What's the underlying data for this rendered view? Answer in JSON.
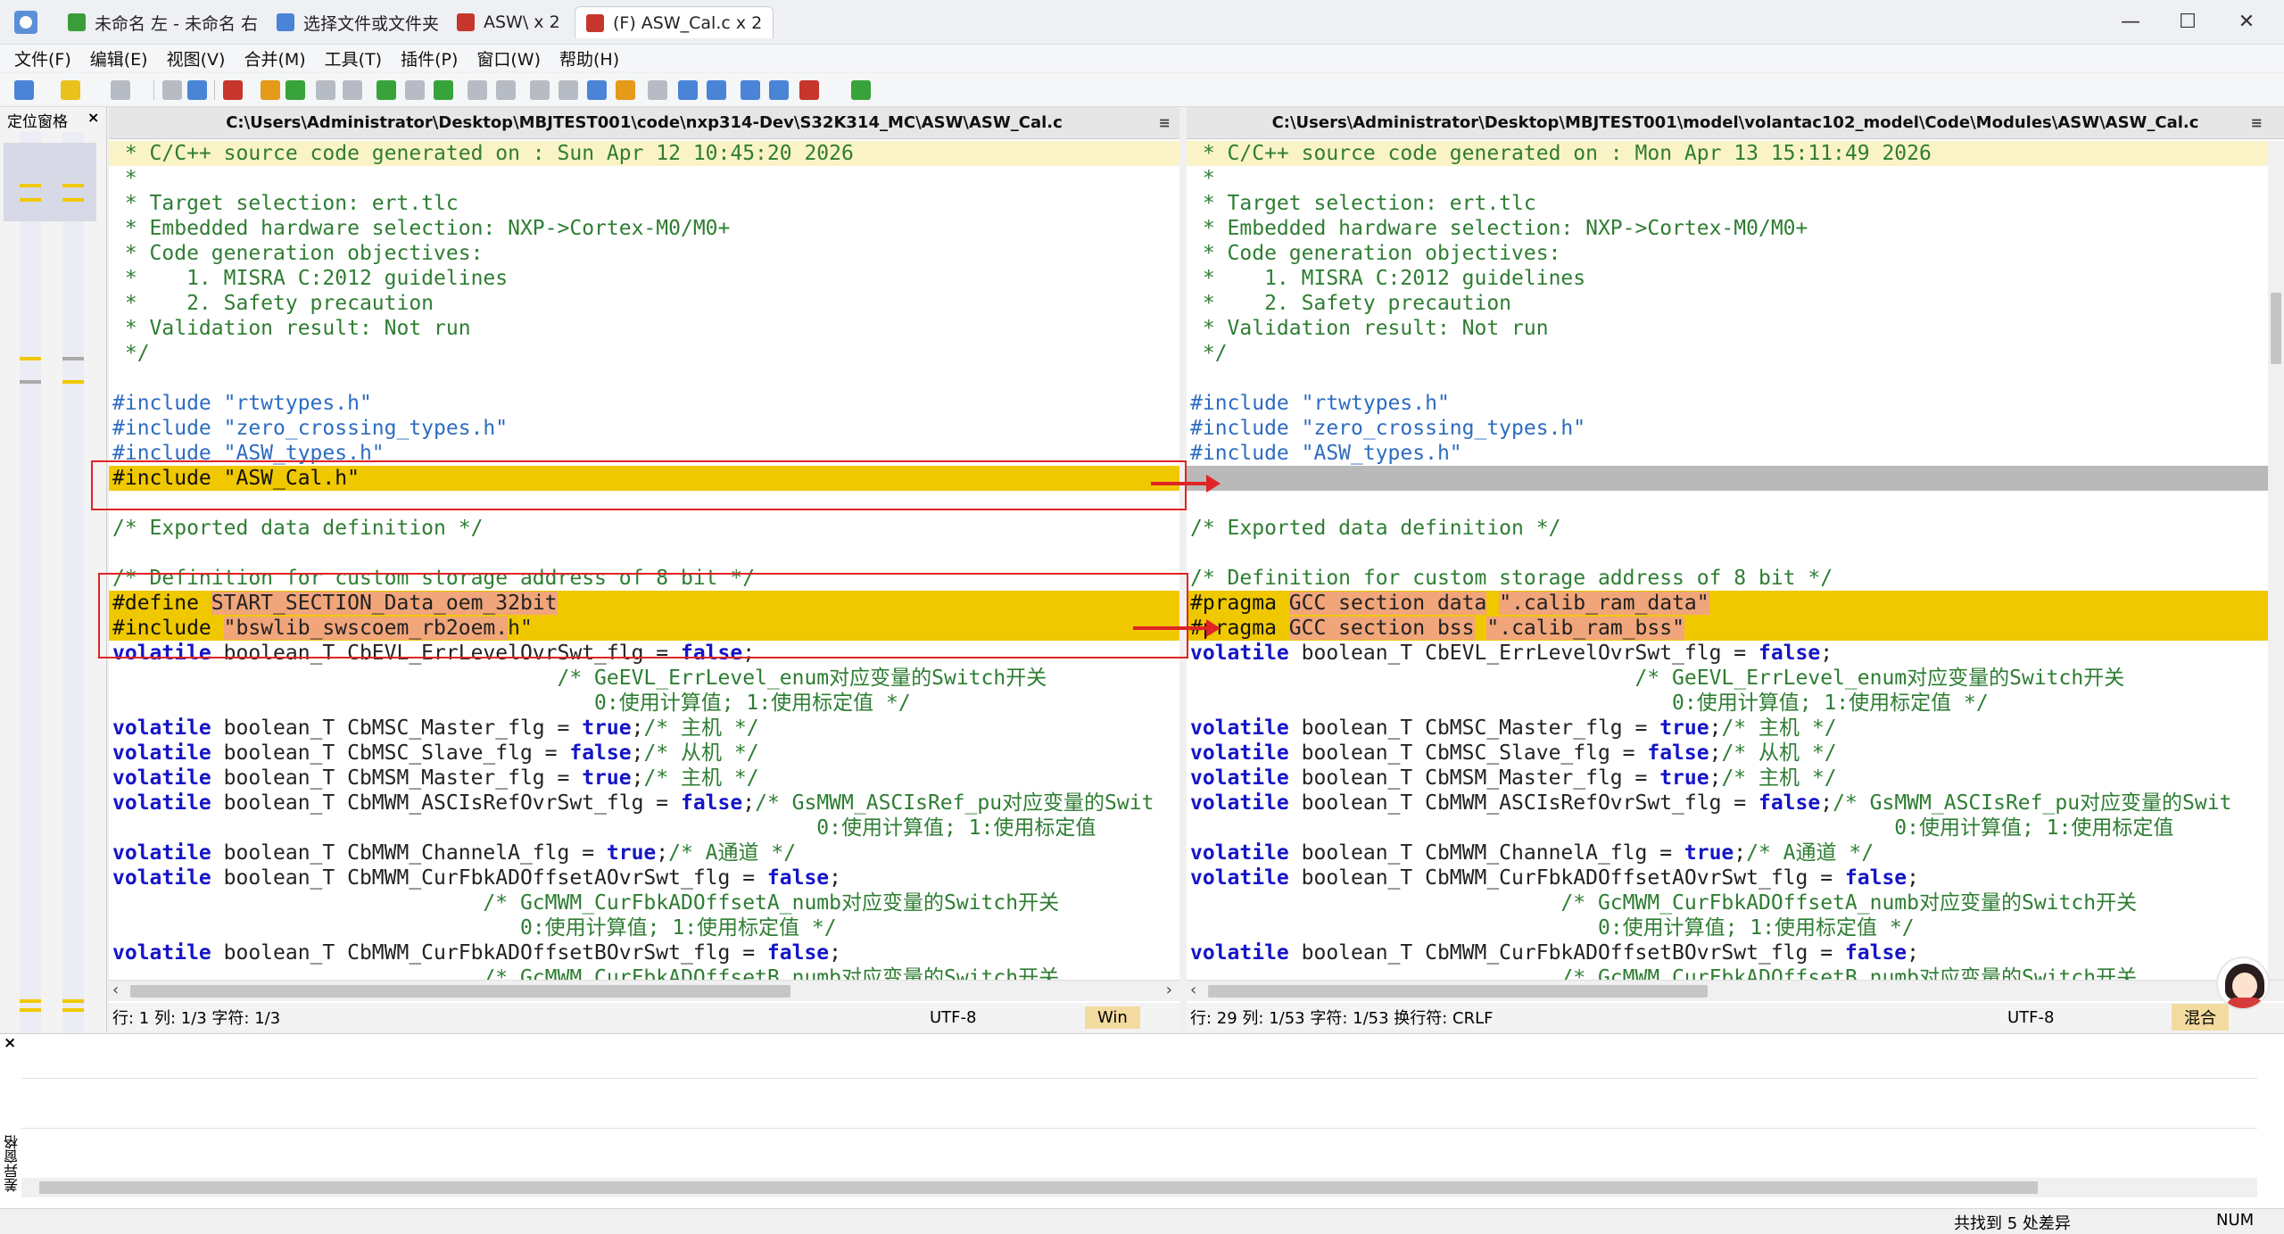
{
  "tabs": [
    {
      "label": "未命名 左 - 未命名 右",
      "icon": "compare-icon",
      "color": "#3a9d3a"
    },
    {
      "label": "选择文件或文件夹",
      "icon": "folder-select-icon",
      "color": "#4a84d6"
    },
    {
      "label": "ASW\\ x 2",
      "icon": "folder-compare-icon",
      "color": "#c7362c"
    },
    {
      "label": "(F) ASW_Cal.c x 2",
      "icon": "file-compare-icon",
      "color": "#c7362c"
    }
  ],
  "window_controls": {
    "minimize": "—",
    "maximize": "☐",
    "close": "✕"
  },
  "menu": [
    "文件(F)",
    "编辑(E)",
    "视图(V)",
    "合并(M)",
    "工具(T)",
    "插件(P)",
    "窗口(W)",
    "帮助(H)"
  ],
  "locator": {
    "title": "定位窗格",
    "close": "×"
  },
  "left_panel": {
    "path": "C:\\Users\\Administrator\\Desktop\\MBJTEST001\\code\\nxp314-Dev\\S32K314_MC\\ASW\\ASW_Cal.c",
    "menu_glyph": "≡",
    "status": {
      "position": "行: 1  列: 1/3  字符: 1/3",
      "encoding": "UTF-8",
      "eol": "Win"
    }
  },
  "right_panel": {
    "path": "C:\\Users\\Administrator\\Desktop\\MBJTEST001\\model\\volantac102_model\\Code\\Modules\\ASW\\ASW_Cal.c",
    "menu_glyph": "≡",
    "status": {
      "position": "行: 29  列: 1/53  字符: 1/53  换行符: CRLF",
      "encoding": "UTF-8",
      "eol": "混合"
    }
  },
  "left_code": [
    [
      [
        "com",
        " * C/C++ source code generated on : Sun Apr 12 10:45:20 2026"
      ]
    ],
    [
      [
        "com",
        " *"
      ]
    ],
    [
      [
        "com",
        " * Target selection: ert.tlc"
      ]
    ],
    [
      [
        "com",
        " * Embedded hardware selection: NXP->Cortex-M0/M0+"
      ]
    ],
    [
      [
        "com",
        " * Code generation objectives:"
      ]
    ],
    [
      [
        "com",
        " *    1. MISRA C:2012 guidelines"
      ]
    ],
    [
      [
        "com",
        " *    2. Safety precaution"
      ]
    ],
    [
      [
        "com",
        " * Validation result: Not run"
      ]
    ],
    [
      [
        "com",
        " */"
      ]
    ],
    [],
    [
      [
        "pp",
        "#include "
      ],
      [
        "str",
        "\"rtwtypes.h\""
      ]
    ],
    [
      [
        "pp",
        "#include "
      ],
      [
        "str",
        "\"zero_crossing_types.h\""
      ]
    ],
    [
      [
        "pp",
        "#include "
      ],
      [
        "str",
        "\"ASW_types.h\""
      ]
    ],
    [
      [
        "pp",
        "#include "
      ],
      [
        "str",
        "\"ASW_Cal.h\""
      ]
    ],
    [],
    [
      [
        "com",
        "/* Exported data definition */"
      ]
    ],
    [],
    [
      [
        "com",
        "/* Definition for custom storage address of 8 bit */"
      ]
    ],
    [
      [
        "pp",
        "#define"
      ],
      [
        "txt",
        " "
      ],
      [
        "chg",
        "START_SECTION_Data_oem_32bit"
      ]
    ],
    [
      [
        "pp",
        "#include"
      ],
      [
        "txt",
        " "
      ],
      [
        "chg",
        "\"bswlib_swscoem_rb2oem."
      ],
      [
        "txt",
        "h\""
      ]
    ],
    [
      [
        "kw",
        "volatile"
      ],
      [
        "txt",
        " boolean_T CbEVL_ErrLevelOvrSwt_flg = "
      ],
      [
        "kw",
        "false"
      ],
      [
        "txt",
        ";"
      ]
    ],
    [
      [
        "txt",
        "                                    "
      ],
      [
        "com",
        "/* GeEVL_ErrLevel_enum对应变量的Switch开关"
      ]
    ],
    [
      [
        "txt",
        "                                       "
      ],
      [
        "com",
        "0:使用计算值; 1:使用标定值 */"
      ]
    ],
    [
      [
        "kw",
        "volatile"
      ],
      [
        "txt",
        " boolean_T CbMSC_Master_flg = "
      ],
      [
        "kw",
        "true"
      ],
      [
        "txt",
        ";"
      ],
      [
        "com",
        "/* 主机 */"
      ]
    ],
    [
      [
        "kw",
        "volatile"
      ],
      [
        "txt",
        " boolean_T CbMSC_Slave_flg = "
      ],
      [
        "kw",
        "false"
      ],
      [
        "txt",
        ";"
      ],
      [
        "com",
        "/* 从机 */"
      ]
    ],
    [
      [
        "kw",
        "volatile"
      ],
      [
        "txt",
        " boolean_T CbMSM_Master_flg = "
      ],
      [
        "kw",
        "true"
      ],
      [
        "txt",
        ";"
      ],
      [
        "com",
        "/* 主机 */"
      ]
    ],
    [
      [
        "kw",
        "volatile"
      ],
      [
        "txt",
        " boolean_T CbMWM_ASCIsRefOvrSwt_flg = "
      ],
      [
        "kw",
        "false"
      ],
      [
        "txt",
        ";"
      ],
      [
        "com",
        "/* GsMWM_ASCIsRef_pu对应变量的Swit"
      ]
    ],
    [
      [
        "txt",
        "                                                         "
      ],
      [
        "com",
        "0:使用计算值; 1:使用标定值"
      ]
    ],
    [
      [
        "kw",
        "volatile"
      ],
      [
        "txt",
        " boolean_T CbMWM_ChannelA_flg = "
      ],
      [
        "kw",
        "true"
      ],
      [
        "txt",
        ";"
      ],
      [
        "com",
        "/* A通道 */"
      ]
    ],
    [
      [
        "kw",
        "volatile"
      ],
      [
        "txt",
        " boolean_T CbMWM_CurFbkADOffsetAOvrSwt_flg = "
      ],
      [
        "kw",
        "false"
      ],
      [
        "txt",
        ";"
      ]
    ],
    [
      [
        "txt",
        "                              "
      ],
      [
        "com",
        "/* GcMWM_CurFbkADOffsetA_numb对应变量的Switch开关"
      ]
    ],
    [
      [
        "txt",
        "                                 "
      ],
      [
        "com",
        "0:使用计算值; 1:使用标定值 */"
      ]
    ],
    [
      [
        "kw",
        "volatile"
      ],
      [
        "txt",
        " boolean_T CbMWM_CurFbkADOffsetBOvrSwt_flg = "
      ],
      [
        "kw",
        "false"
      ],
      [
        "txt",
        ";"
      ]
    ],
    [
      [
        "txt",
        "                              "
      ],
      [
        "com",
        "/* GcMWM_CurFbkADOffsetB_numb对应变量的Switch开关"
      ]
    ]
  ],
  "right_code": [
    [
      [
        "com",
        " * C/C++ source code generated on : Mon Apr 13 15:11:49 2026"
      ]
    ],
    [
      [
        "com",
        " *"
      ]
    ],
    [
      [
        "com",
        " * Target selection: ert.tlc"
      ]
    ],
    [
      [
        "com",
        " * Embedded hardware selection: NXP->Cortex-M0/M0+"
      ]
    ],
    [
      [
        "com",
        " * Code generation objectives:"
      ]
    ],
    [
      [
        "com",
        " *    1. MISRA C:2012 guidelines"
      ]
    ],
    [
      [
        "com",
        " *    2. Safety precaution"
      ]
    ],
    [
      [
        "com",
        " * Validation result: Not run"
      ]
    ],
    [
      [
        "com",
        " */"
      ]
    ],
    [],
    [
      [
        "pp",
        "#include "
      ],
      [
        "str",
        "\"rtwtypes.h\""
      ]
    ],
    [
      [
        "pp",
        "#include "
      ],
      [
        "str",
        "\"zero_crossing_types.h\""
      ]
    ],
    [
      [
        "pp",
        "#include "
      ],
      [
        "str",
        "\"ASW_types.h\""
      ]
    ],
    [],
    [],
    [
      [
        "com",
        "/* Exported data definition */"
      ]
    ],
    [],
    [
      [
        "com",
        "/* Definition for custom storage address of 8 bit */"
      ]
    ],
    [
      [
        "pp",
        "#pragma"
      ],
      [
        "txt",
        " "
      ],
      [
        "chg",
        "GCC section data"
      ],
      [
        "txt",
        " "
      ],
      [
        "chg",
        "\".calib_ram_data\""
      ]
    ],
    [
      [
        "pp",
        "#pragma"
      ],
      [
        "txt",
        " "
      ],
      [
        "chg",
        "GCC section bss"
      ],
      [
        "txt",
        " "
      ],
      [
        "chg",
        "\".calib_ram_bss\""
      ]
    ],
    [
      [
        "kw",
        "volatile"
      ],
      [
        "txt",
        " boolean_T CbEVL_ErrLevelOvrSwt_flg = "
      ],
      [
        "kw",
        "false"
      ],
      [
        "txt",
        ";"
      ]
    ],
    [
      [
        "txt",
        "                                    "
      ],
      [
        "com",
        "/* GeEVL_ErrLevel_enum对应变量的Switch开关"
      ]
    ],
    [
      [
        "txt",
        "                                       "
      ],
      [
        "com",
        "0:使用计算值; 1:使用标定值 */"
      ]
    ],
    [
      [
        "kw",
        "volatile"
      ],
      [
        "txt",
        " boolean_T CbMSC_Master_flg = "
      ],
      [
        "kw",
        "true"
      ],
      [
        "txt",
        ";"
      ],
      [
        "com",
        "/* 主机 */"
      ]
    ],
    [
      [
        "kw",
        "volatile"
      ],
      [
        "txt",
        " boolean_T CbMSC_Slave_flg = "
      ],
      [
        "kw",
        "false"
      ],
      [
        "txt",
        ";"
      ],
      [
        "com",
        "/* 从机 */"
      ]
    ],
    [
      [
        "kw",
        "volatile"
      ],
      [
        "txt",
        " boolean_T CbMSM_Master_flg = "
      ],
      [
        "kw",
        "true"
      ],
      [
        "txt",
        ";"
      ],
      [
        "com",
        "/* 主机 */"
      ]
    ],
    [
      [
        "kw",
        "volatile"
      ],
      [
        "txt",
        " boolean_T CbMWM_ASCIsRefOvrSwt_flg = "
      ],
      [
        "kw",
        "false"
      ],
      [
        "txt",
        ";"
      ],
      [
        "com",
        "/* GsMWM_ASCIsRef_pu对应变量的Swit"
      ]
    ],
    [
      [
        "txt",
        "                                                         "
      ],
      [
        "com",
        "0:使用计算值; 1:使用标定值"
      ]
    ],
    [
      [
        "kw",
        "volatile"
      ],
      [
        "txt",
        " boolean_T CbMWM_ChannelA_flg = "
      ],
      [
        "kw",
        "true"
      ],
      [
        "txt",
        ";"
      ],
      [
        "com",
        "/* A通道 */"
      ]
    ],
    [
      [
        "kw",
        "volatile"
      ],
      [
        "txt",
        " boolean_T CbMWM_CurFbkADOffsetAOvrSwt_flg = "
      ],
      [
        "kw",
        "false"
      ],
      [
        "txt",
        ";"
      ]
    ],
    [
      [
        "txt",
        "                              "
      ],
      [
        "com",
        "/* GcMWM_CurFbkADOffsetA_numb对应变量的Switch开关"
      ]
    ],
    [
      [
        "txt",
        "                                 "
      ],
      [
        "com",
        "0:使用计算值; 1:使用标定值 */"
      ]
    ],
    [
      [
        "kw",
        "volatile"
      ],
      [
        "txt",
        " boolean_T CbMWM_CurFbkADOffsetBOvrSwt_flg = "
      ],
      [
        "kw",
        "false"
      ],
      [
        "txt",
        ";"
      ]
    ],
    [
      [
        "txt",
        "                              "
      ],
      [
        "com",
        "/* GcMWM_CurFbkADOffsetB_numb对应变量的Switch开关"
      ]
    ]
  ],
  "left_line_states": [
    "hl-light",
    "",
    "",
    "",
    "",
    "",
    "",
    "",
    "",
    "",
    "",
    "",
    "",
    "hl",
    "",
    "",
    "",
    "",
    "hl",
    "hl",
    "",
    "",
    "",
    "",
    "",
    "",
    "",
    "",
    "",
    "",
    "",
    "",
    "",
    ""
  ],
  "right_line_states": [
    "hl-light",
    "",
    "",
    "",
    "",
    "",
    "",
    "",
    "",
    "",
    "",
    "",
    "",
    "gap",
    "",
    "",
    "",
    "",
    "hl",
    "hl",
    "",
    "",
    "",
    "",
    "",
    "",
    "",
    "",
    "",
    "",
    "",
    "",
    "",
    ""
  ],
  "diff_pane": {
    "title": "差异窗格",
    "close": "×"
  },
  "bottom_status": {
    "summary": "共找到 5 处差异",
    "numlock": "NUM"
  },
  "colors": {
    "diff_highlight": "#f0c800",
    "change_span": "#f1a57a",
    "annotation_red": "#e02424",
    "gap_line": "#b9b9b9"
  }
}
